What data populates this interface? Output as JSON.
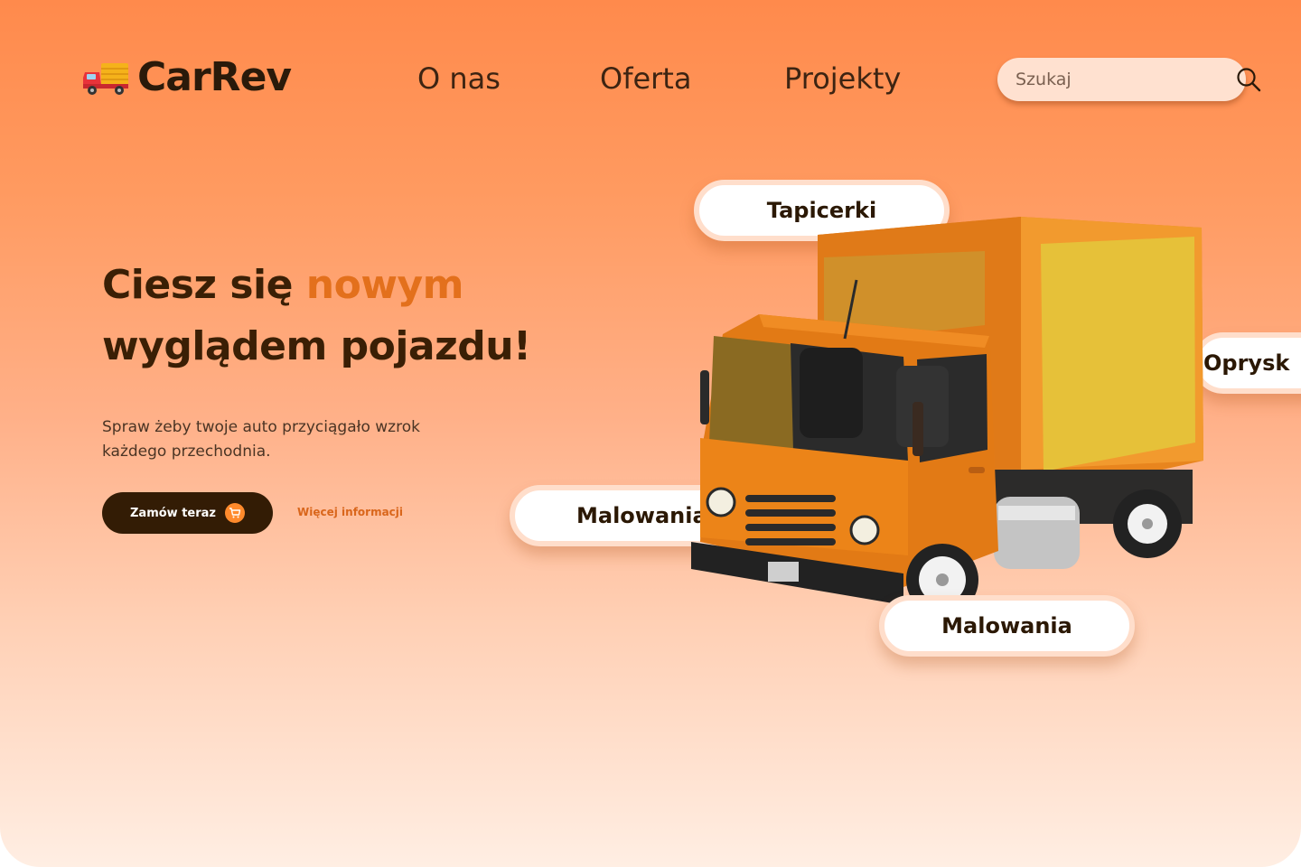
{
  "header": {
    "logo_text": "CarRev",
    "logo_icon": "delivery-truck-emoji",
    "nav": [
      {
        "label": "O nas"
      },
      {
        "label": "Oferta"
      },
      {
        "label": "Projekty"
      }
    ],
    "search": {
      "placeholder": "Szukaj",
      "icon": "search-icon"
    }
  },
  "hero": {
    "title_part1": "Ciesz się ",
    "title_accent": "nowym",
    "title_part2": "wyglądem pojazdu!",
    "subtitle": "Spraw żeby twoje auto przyciągało wzrok każdego przechodnia.",
    "cta_label": "Zamów teraz",
    "cta_icon": "cart-icon",
    "more_link": "Więcej informacji"
  },
  "services": [
    {
      "label": "Tapicerki"
    },
    {
      "label": "Oprysk"
    },
    {
      "label": "Malowania"
    },
    {
      "label": "Malowania"
    }
  ],
  "colors": {
    "accent": "#e3701c",
    "dark": "#331c05",
    "background_top": "#ff8a4c",
    "background_bottom": "#ffeee3"
  }
}
